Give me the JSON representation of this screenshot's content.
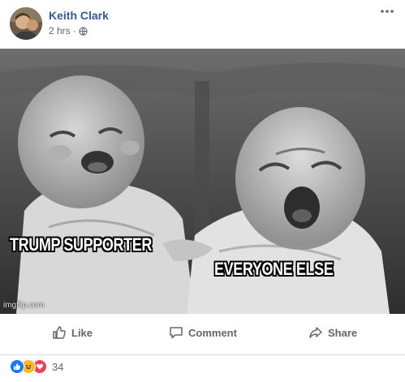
{
  "post": {
    "author": "Keith Clark",
    "time": "2 hrs",
    "separator": "·",
    "privacy_icon": "globe-icon",
    "more_icon": "more-options-icon"
  },
  "image": {
    "caption_left": "TRUMP SUPPORTER",
    "caption_right": "EVERYONE ELSE",
    "watermark": "imgflip.com"
  },
  "actions": {
    "like": "Like",
    "comment": "Comment",
    "share": "Share"
  },
  "reactions": {
    "icons": [
      "like-reaction-icon",
      "haha-reaction-icon",
      "love-reaction-icon"
    ],
    "count": "34"
  },
  "colors": {
    "author_link": "#385898",
    "meta_text": "#616770",
    "action_text": "#606770",
    "like_blue": "#1877f2",
    "haha_yellow": "#f7b928",
    "love_red": "#f33e58"
  }
}
